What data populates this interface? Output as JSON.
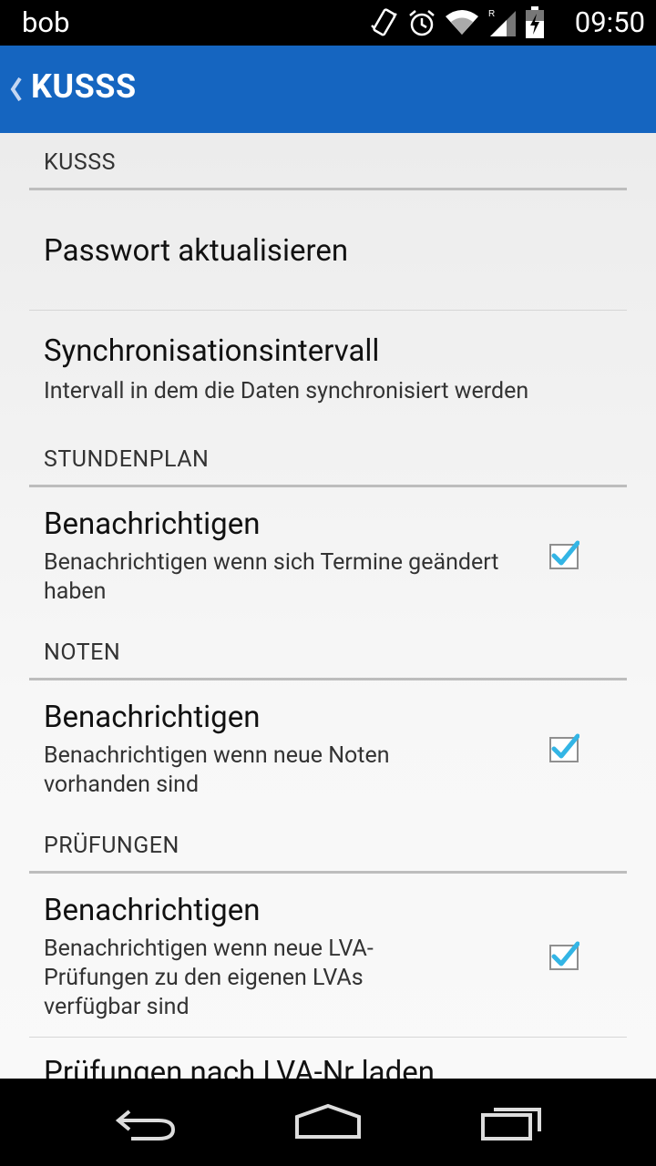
{
  "status_bar": {
    "carrier": "bob",
    "time": "09:50"
  },
  "action_bar": {
    "title": "KUSSS"
  },
  "sections": {
    "kusss": {
      "header": "KUSSS",
      "update_password": {
        "title": "Passwort aktualisieren"
      },
      "sync_interval": {
        "title": "Synchronisationsintervall",
        "summary": "Intervall in dem die Daten synchronisiert werden"
      }
    },
    "timetable": {
      "header": "STUNDENPLAN",
      "notify": {
        "title": "Benachrichtigen",
        "summary": "Benachrichtigen wenn sich Termine geändert haben",
        "checked": true
      }
    },
    "grades": {
      "header": "NOTEN",
      "notify": {
        "title": "Benachrichtigen",
        "summary": "Benachrichtigen wenn neue Noten vorhanden sind",
        "checked": true
      }
    },
    "exams": {
      "header": "PRÜFUNGEN",
      "notify": {
        "title": "Benachrichtigen",
        "summary": "Benachrichtigen wenn neue LVA-Prüfungen zu den eigenen LVAs verfügbar sind",
        "checked": true
      },
      "load_by_number": {
        "title": "Prüfungen nach LVA-Nr laden"
      }
    }
  },
  "colors": {
    "accent": "#1565c0",
    "checkmark": "#33b5e5"
  }
}
